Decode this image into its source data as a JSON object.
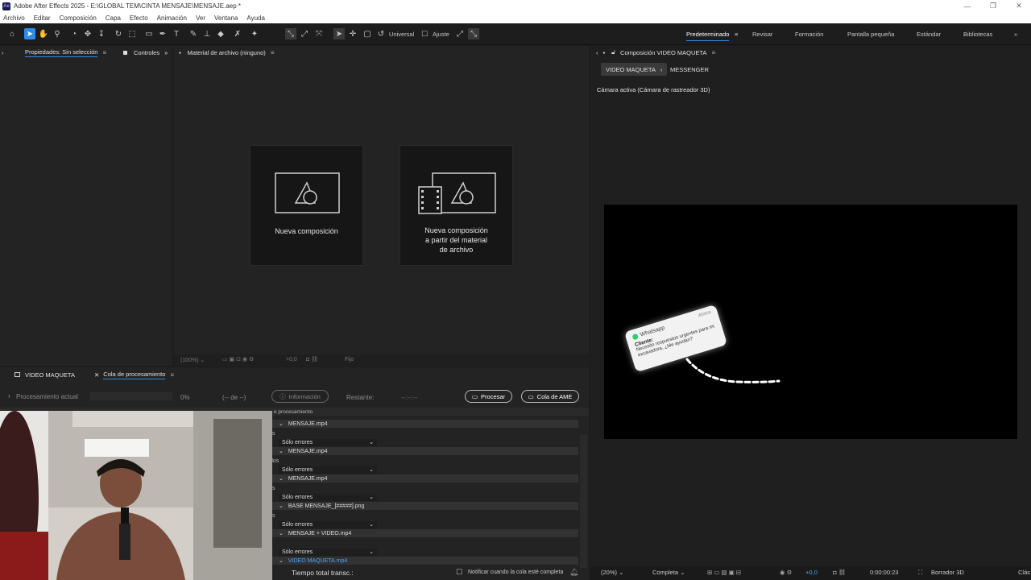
{
  "titlebar": {
    "app_badge": "Ae",
    "title": "Adobe After Effects 2025 - E:\\GLOBAL TEM\\CINTA MENSAJE\\MENSAJE.aep *"
  },
  "menu": [
    "Archivo",
    "Editar",
    "Composición",
    "Capa",
    "Efecto",
    "Animación",
    "Ver",
    "Ventana",
    "Ayuda"
  ],
  "toolbar": {
    "universal": "Universal",
    "ajuste": "Ajuste"
  },
  "workspaces": [
    "Predeterminado",
    "Revisar",
    "Formación",
    "Pantalla pequeña",
    "Estándar",
    "Bibliotecas"
  ],
  "left_panel": {
    "tab_properties": "Propiedades: Sin selección",
    "tab_controls": "Controles"
  },
  "footage_panel": {
    "title": "Material de archivo (ninguno)",
    "new_comp": "Nueva composición",
    "new_comp_from_footage": [
      "Nueva composición",
      "a partir del material",
      "de archivo"
    ],
    "zoom": "(100%)",
    "exposure": "+0,0",
    "fixed": "Fijo"
  },
  "comp_panel": {
    "title": "Composición VIDEO MAQUETA",
    "tabs": [
      "VIDEO MAQUETA",
      "MESSENGER"
    ],
    "camera": "Cámara activa (Cámara de rastreador 3D)",
    "zoom": "(20%)",
    "resolution": "Completa",
    "exposure": "+0,0",
    "timecode": "0:00:00:23",
    "renderer": "Borrador 3D",
    "right_cut": "Clás"
  },
  "notification": {
    "app": "Whatsapp",
    "time": "Ahora",
    "from": "Cliente:",
    "message": "Necesito respuestos urgentes para mi excavadora, ¿Me ayudan?"
  },
  "bottom_panel": {
    "tab_video": "VIDEO MAQUETA",
    "tab_queue": "Cola de procesamiento",
    "current": "Procesamiento actual",
    "percent": "0%",
    "of": "(-- de --)",
    "info": "Información",
    "remaining": "Restante:",
    "remaining_val": "--:--:--",
    "process": "Procesar",
    "ame": "Cola de AME",
    "col_hint": "e procesamiento",
    "items": [
      {
        "name": "MENSAJE.mp4",
        "log": "Sólo errores"
      },
      {
        "name": "MENSAJE.mp4",
        "log": "Sólo errores"
      },
      {
        "name": "MENSAJE.mp4",
        "log": "Sólo errores"
      },
      {
        "name": "BASE MENSAJE_[#####].png",
        "log": "Sólo errores"
      },
      {
        "name": "MENSAJE + VIDEO.mp4",
        "log": "Sólo errores"
      },
      {
        "name": "VIDEO MAQUETA.mp4",
        "log": ""
      }
    ],
    "edge_labels": [
      "s",
      "dos",
      "s",
      "s"
    ],
    "total_time": "Tiempo total transc.:",
    "notify": "Notificar cuando la cola esté completa"
  },
  "colors": {
    "accent": "#2d8ceb",
    "panel": "#232323",
    "bg": "#1d1d1d"
  }
}
